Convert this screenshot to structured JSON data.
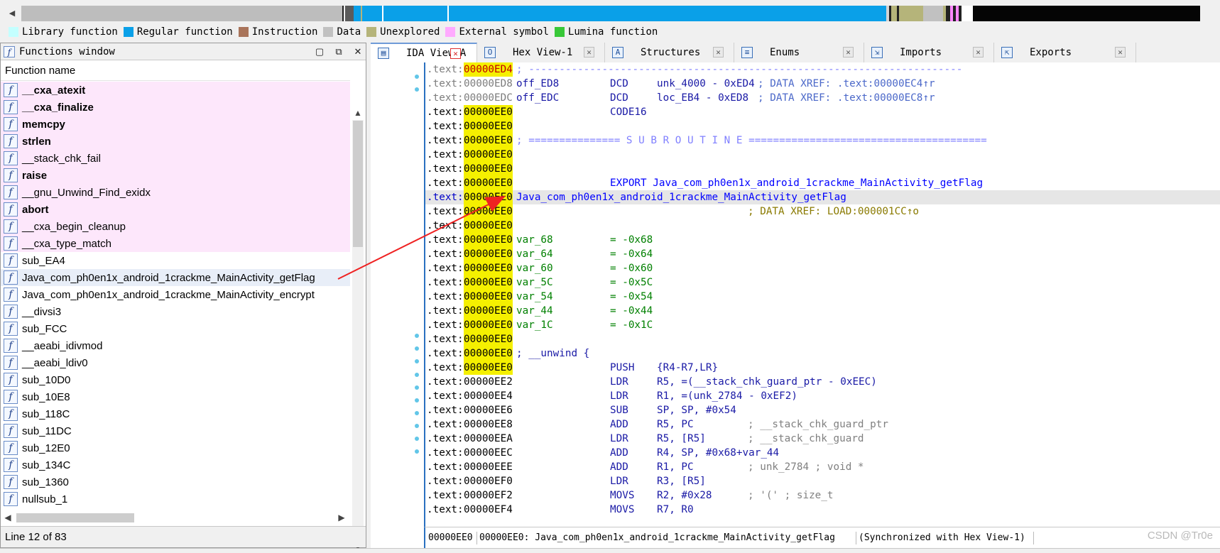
{
  "legend": [
    {
      "label": "Library function",
      "color": "#c4ffff"
    },
    {
      "label": "Regular function",
      "color": "#0aa0e8"
    },
    {
      "label": "Instruction",
      "color": "#a9745a"
    },
    {
      "label": "Data",
      "color": "#c1c1c1"
    },
    {
      "label": "Unexplored",
      "color": "#b5b47a"
    },
    {
      "label": "External symbol",
      "color": "#ffaaff"
    },
    {
      "label": "Lumina function",
      "color": "#38c838"
    }
  ],
  "functions_window": {
    "title": "Functions window",
    "column_header": "Function name",
    "status": "Line 12 of 83",
    "items": [
      {
        "name": "__cxa_atexit",
        "lib": true,
        "bold": true
      },
      {
        "name": "__cxa_finalize",
        "lib": true,
        "bold": true
      },
      {
        "name": "memcpy",
        "lib": true,
        "bold": true
      },
      {
        "name": "strlen",
        "lib": true,
        "bold": true
      },
      {
        "name": "__stack_chk_fail",
        "lib": true,
        "bold": false
      },
      {
        "name": "raise",
        "lib": true,
        "bold": true
      },
      {
        "name": "__gnu_Unwind_Find_exidx",
        "lib": true,
        "bold": false
      },
      {
        "name": "abort",
        "lib": true,
        "bold": true
      },
      {
        "name": "__cxa_begin_cleanup",
        "lib": true,
        "bold": false
      },
      {
        "name": "__cxa_type_match",
        "lib": true,
        "bold": false
      },
      {
        "name": "sub_EA4",
        "lib": false,
        "bold": false
      },
      {
        "name": "Java_com_ph0en1x_android_1crackme_MainActivity_getFlag",
        "lib": false,
        "bold": false,
        "selected": true
      },
      {
        "name": "Java_com_ph0en1x_android_1crackme_MainActivity_encrypt",
        "lib": false,
        "bold": false
      },
      {
        "name": "__divsi3",
        "lib": false,
        "bold": false
      },
      {
        "name": "sub_FCC",
        "lib": false,
        "bold": false
      },
      {
        "name": "__aeabi_idivmod",
        "lib": false,
        "bold": false
      },
      {
        "name": "__aeabi_ldiv0",
        "lib": false,
        "bold": false
      },
      {
        "name": "sub_10D0",
        "lib": false,
        "bold": false
      },
      {
        "name": "sub_10E8",
        "lib": false,
        "bold": false
      },
      {
        "name": "sub_118C",
        "lib": false,
        "bold": false
      },
      {
        "name": "sub_11DC",
        "lib": false,
        "bold": false
      },
      {
        "name": "sub_12E0",
        "lib": false,
        "bold": false
      },
      {
        "name": "sub_134C",
        "lib": false,
        "bold": false
      },
      {
        "name": "sub_1360",
        "lib": false,
        "bold": false
      },
      {
        "name": "nullsub_1",
        "lib": false,
        "bold": false
      }
    ]
  },
  "tabs": [
    {
      "label": "IDA View-A",
      "icon": "ida-view-icon",
      "glyph": "▤",
      "active": true
    },
    {
      "label": "Hex View-1",
      "icon": "hex-view-icon",
      "glyph": "O",
      "active": false
    },
    {
      "label": "Structures",
      "icon": "structures-icon",
      "glyph": "A",
      "active": false
    },
    {
      "label": "Enums",
      "icon": "enums-icon",
      "glyph": "≡",
      "active": false
    },
    {
      "label": "Imports",
      "icon": "imports-icon",
      "glyph": "⇲",
      "active": false
    },
    {
      "label": "Exports",
      "icon": "exports-icon",
      "glyph": "⇱",
      "active": false
    }
  ],
  "disasm": {
    "lines": [
      {
        "seg": ".text",
        "addr": "00000ED4",
        "segstyle": "seg-dim",
        "addrstyle": "addr-hl-red",
        "sep": "; -----------------------------------------------------------------------"
      },
      {
        "seg": ".text",
        "addr": "00000ED8",
        "segstyle": "seg-dim",
        "addrstyle": "addr-dim",
        "label": "off_ED8",
        "mnem": "DCD",
        "opnd": "unk_4000 - 0xED4",
        "xref": "; DATA XREF: .text:00000EC4↑r"
      },
      {
        "seg": ".text",
        "addr": "00000EDC",
        "segstyle": "seg-dim",
        "addrstyle": "addr-dim",
        "label": "off_EDC",
        "mnem": "DCD",
        "opnd": "loc_EB4 - 0xED8",
        "xref": "; DATA XREF: .text:00000EC8↑r"
      },
      {
        "seg": ".text",
        "addr": "00000EE0",
        "addrstyle": "addr-hl",
        "mnem": "CODE16"
      },
      {
        "seg": ".text",
        "addr": "00000EE0",
        "addrstyle": "addr-hl"
      },
      {
        "seg": ".text",
        "addr": "00000EE0",
        "addrstyle": "addr-hl",
        "sep": "; =============== S U B R O U T I N E ======================================="
      },
      {
        "seg": ".text",
        "addr": "00000EE0",
        "addrstyle": "addr-hl"
      },
      {
        "seg": ".text",
        "addr": "00000EE0",
        "addrstyle": "addr-hl"
      },
      {
        "seg": ".text",
        "addr": "00000EE0",
        "addrstyle": "addr-hl",
        "export": "EXPORT Java_com_ph0en1x_android_1crackme_MainActivity_getFlag"
      },
      {
        "seg": ".text",
        "addr": "00000EE0",
        "addrstyle": "addr-hl",
        "segstyle": "seg-blue",
        "current": true,
        "funclabel": "Java_com_ph0en1x_android_1crackme_MainActivity_getFlag"
      },
      {
        "seg": ".text",
        "addr": "00000EE0",
        "addrstyle": "addr-hl",
        "dataxref": "; DATA XREF: LOAD:000001CC↑o"
      },
      {
        "seg": ".text",
        "addr": "00000EE0",
        "addrstyle": "addr-hl"
      },
      {
        "seg": ".text",
        "addr": "00000EE0",
        "addrstyle": "addr-hl",
        "var": "var_68",
        "val": "= -0x68"
      },
      {
        "seg": ".text",
        "addr": "00000EE0",
        "addrstyle": "addr-hl",
        "var": "var_64",
        "val": "= -0x64"
      },
      {
        "seg": ".text",
        "addr": "00000EE0",
        "addrstyle": "addr-hl",
        "var": "var_60",
        "val": "= -0x60"
      },
      {
        "seg": ".text",
        "addr": "00000EE0",
        "addrstyle": "addr-hl",
        "var": "var_5C",
        "val": "= -0x5C"
      },
      {
        "seg": ".text",
        "addr": "00000EE0",
        "addrstyle": "addr-hl",
        "var": "var_54",
        "val": "= -0x54"
      },
      {
        "seg": ".text",
        "addr": "00000EE0",
        "addrstyle": "addr-hl",
        "var": "var_44",
        "val": "= -0x44"
      },
      {
        "seg": ".text",
        "addr": "00000EE0",
        "addrstyle": "addr-hl",
        "var": "var_1C",
        "val": "= -0x1C"
      },
      {
        "seg": ".text",
        "addr": "00000EE0",
        "addrstyle": "addr-hl"
      },
      {
        "seg": ".text",
        "addr": "00000EE0",
        "addrstyle": "addr-hl",
        "unwind": "; __unwind {"
      },
      {
        "seg": ".text",
        "addr": "00000EE0",
        "addrstyle": "addr-hl",
        "mnem": "PUSH",
        "opnd": "{R4-R7,LR}"
      },
      {
        "seg": ".text",
        "addr": "00000EE2",
        "addrstyle": "addr",
        "mnem": "LDR",
        "opnd": "R5, =(__stack_chk_guard_ptr - 0xEEC)"
      },
      {
        "seg": ".text",
        "addr": "00000EE4",
        "addrstyle": "addr",
        "mnem": "LDR",
        "opnd": "R1, =(unk_2784 - 0xEF2)"
      },
      {
        "seg": ".text",
        "addr": "00000EE6",
        "addrstyle": "addr",
        "mnem": "SUB",
        "opnd": "SP, SP, #0x54"
      },
      {
        "seg": ".text",
        "addr": "00000EE8",
        "addrstyle": "addr",
        "mnem": "ADD",
        "opnd": "R5, PC",
        "cmt": "; __stack_chk_guard_ptr"
      },
      {
        "seg": ".text",
        "addr": "00000EEA",
        "addrstyle": "addr",
        "mnem": "LDR",
        "opnd": "R5, [R5]",
        "cmt": "; __stack_chk_guard"
      },
      {
        "seg": ".text",
        "addr": "00000EEC",
        "addrstyle": "addr",
        "mnem": "ADD",
        "opnd": "R4, SP, #0x68+var_44"
      },
      {
        "seg": ".text",
        "addr": "00000EEE",
        "addrstyle": "addr",
        "mnem": "ADD",
        "opnd": "R1, PC",
        "cmt": "; unk_2784 ; void *"
      },
      {
        "seg": ".text",
        "addr": "00000EF0",
        "addrstyle": "addr",
        "mnem": "LDR",
        "opnd": "R3, [R5]"
      },
      {
        "seg": ".text",
        "addr": "00000EF2",
        "addrstyle": "addr",
        "mnem": "MOVS",
        "opnd": "R2, #0x28",
        "cmt": "; '(' ; size_t"
      },
      {
        "seg": ".text",
        "addr": "00000EF4",
        "addrstyle": "addr",
        "mnem": "MOVS",
        "opnd": "R7, R0"
      }
    ],
    "infobar": {
      "offset": "00000EE0",
      "location": "00000EE0: Java_com_ph0en1x_android_1crackme_MainActivity_getFlag",
      "sync": "(Synchronized with Hex View-1)"
    }
  },
  "watermark": "CSDN @Tr0e"
}
